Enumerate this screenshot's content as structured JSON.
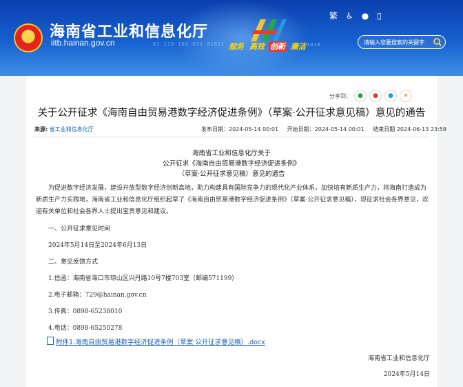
{
  "header": {
    "site_title": "海南省工业和信息化厅",
    "site_url": "iitb.hainan.gov.cn",
    "binary_text": "01 110 101 011 01011",
    "binary_text2": "1010",
    "slogan": [
      "服务",
      "高效",
      "创新",
      "廉洁"
    ],
    "top_icons": [
      "traditional-chinese-icon",
      "accessibility-icon",
      "wechat-icon",
      "mobile-icon"
    ],
    "top_icon_glyphs": [
      "繁",
      "♿",
      "●",
      "▯"
    ],
    "search_placeholder": "请输入您要搜索的关键字"
  },
  "article": {
    "share_label": "分享到：",
    "title": "关于公开征求《海南自由贸易港数字经济促进条例》（草案·公开征求意见稿）意见的通告",
    "source_label": "来源:",
    "source_value": "省工业和信息化厅",
    "publish_date": "发布日期：2024-05-14 00:01",
    "start_date": "开始日期：2024-05-14 00:01",
    "end_date": "结束日期 2024-06-13 23:59",
    "doc_heading": [
      "海南省工业和信息化厅关于",
      "公开征求《海南自由贸易港数字经济促进条例》",
      "（草案·公开征求意见稿）意见的通告"
    ],
    "intro": "为促进数字经济发展，建设开放型数字经济创新高地，助力构建具有国际竞争力的现代化产业体系，加快培育新质生产力，将海南打造成为新质生产力实践地，海南省工业和信息化厅组织起草了《海南自由贸易港数字经济促进条例》（草案·公开征求意见稿），现征求社会各界意见，欢迎有关单位和社会各界人士提出宝贵意见和建议。",
    "section1_title": "一、公开征求意见时间",
    "section1_body": "2024年5月14日至2024年6月13日",
    "section2_title": "二、意见反馈方式",
    "item1": "1.信函：海南省海口市琼山区兴丹路10号7楼703室（邮编571199）",
    "item2": "2.电子邮箱：729@hainan.gov.cn",
    "item3": "3.传真：0898-65238010",
    "item4": "4.电话：0898-65250278",
    "attachment": "附件1.海南自由贸易港数字经济促进条例（草案·公开征求意见稿）.docx",
    "signature_org": "海南省工业和信息化厅",
    "signature_date": "2024年5月14日"
  },
  "colors": {
    "banner_top": "#0b3fae",
    "banner_bottom": "#3f8fe6",
    "link": "#1a5fb4",
    "slogan_highlight": "#e53c2f"
  }
}
